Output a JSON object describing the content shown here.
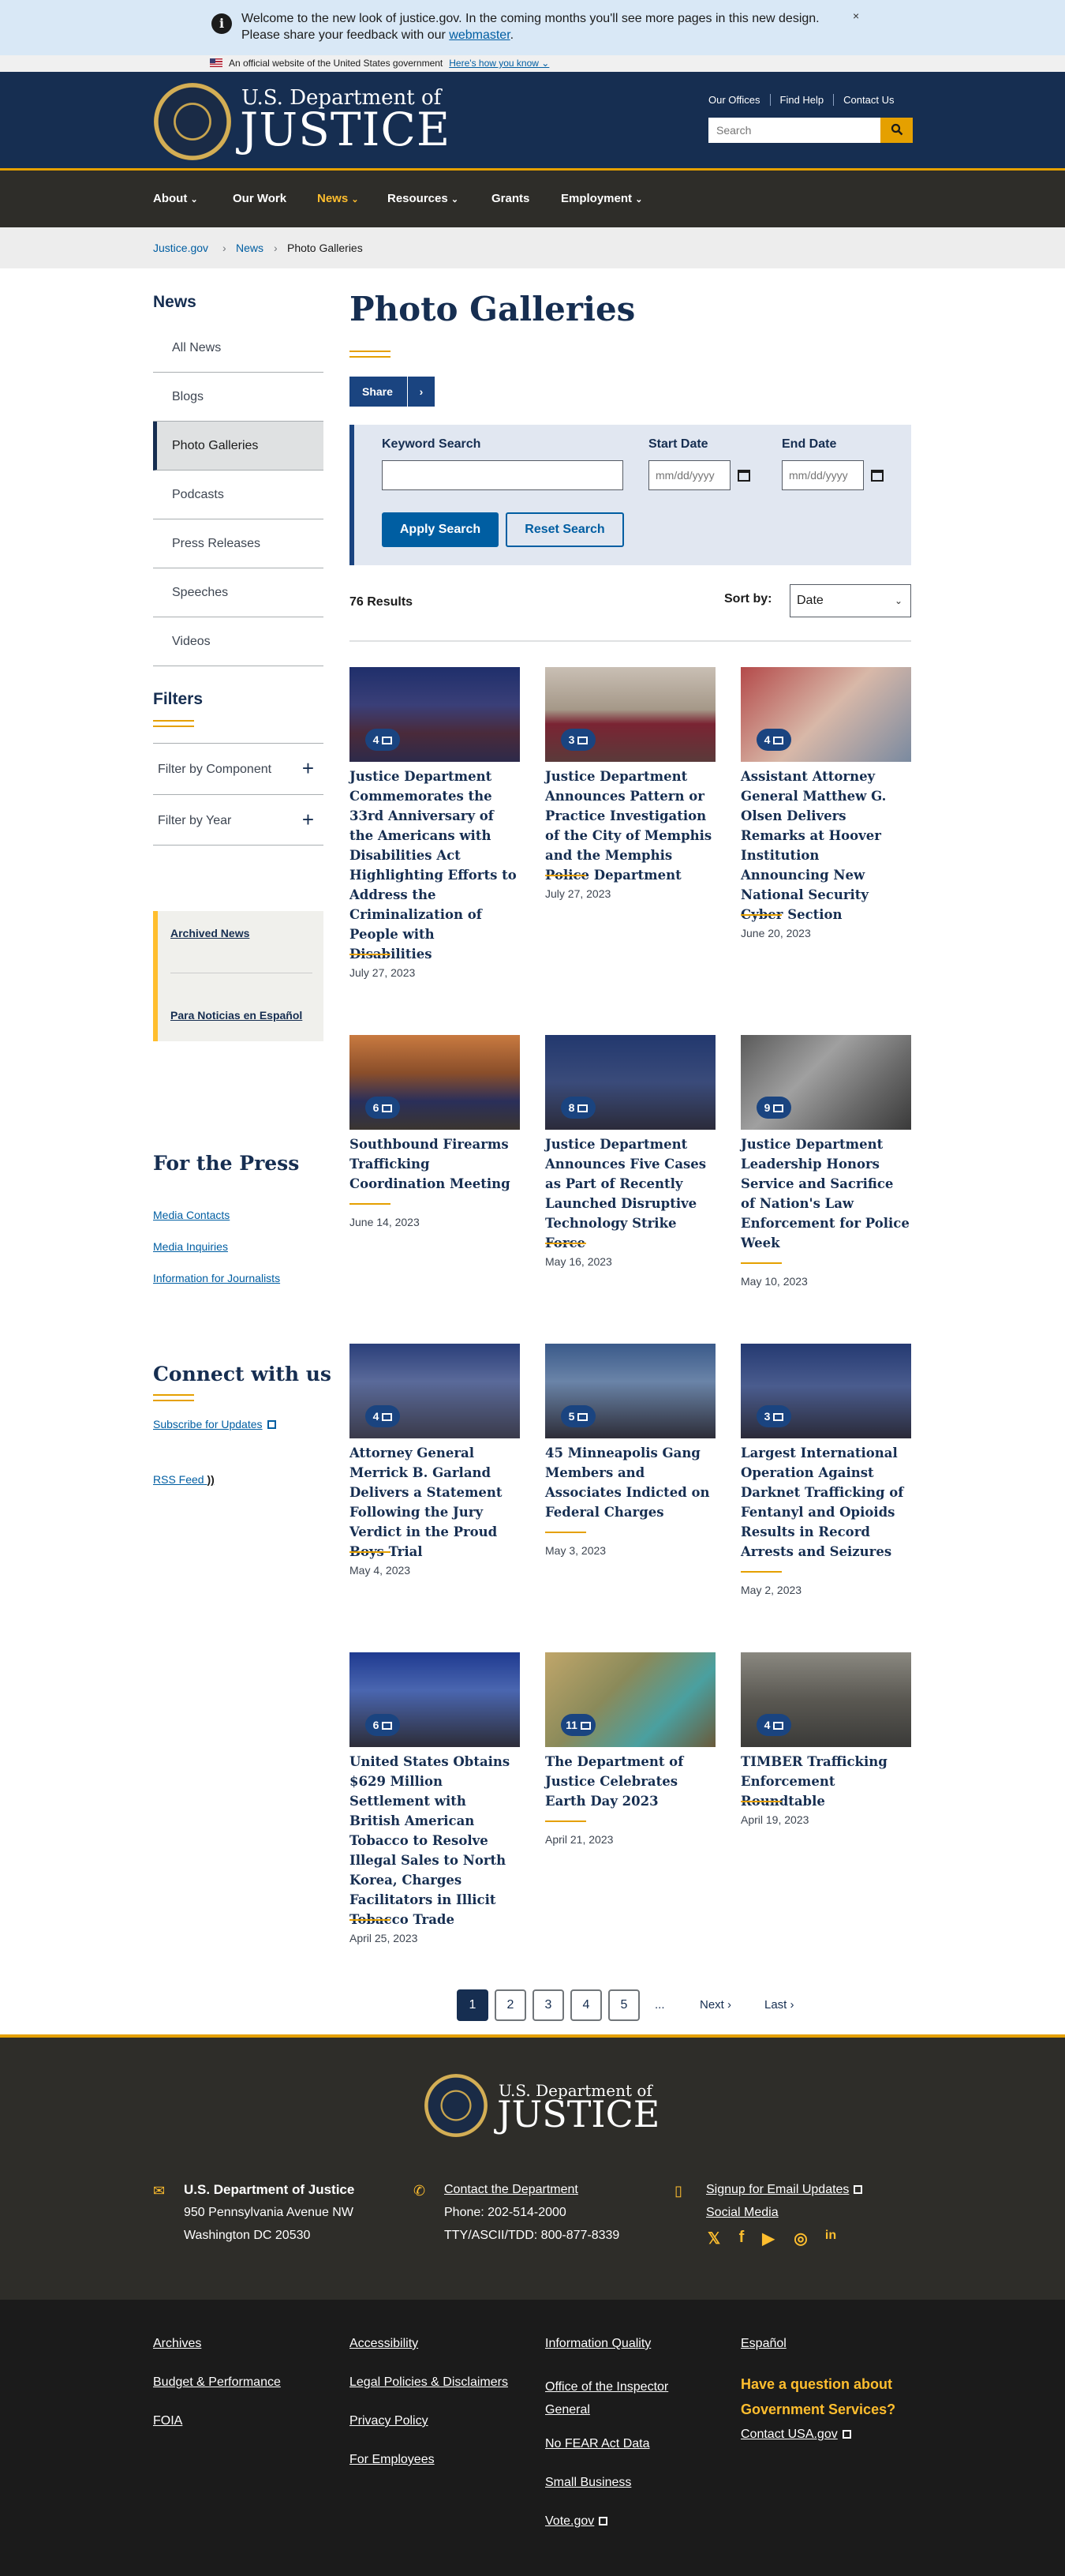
{
  "alert": {
    "message": "Welcome to the new look of justice.gov. In the coming months you'll see more pages in this new design. Please share your feedback with our",
    "link": "webmaster",
    "close": "×"
  },
  "gov_banner": {
    "text": "An official website of the United States government",
    "how": "Here's how you know"
  },
  "header": {
    "dept_line1": "U.S. Department of",
    "dept_line2": "JUSTICE",
    "util_links": [
      "Our Offices",
      "Find Help",
      "Contact Us"
    ],
    "search_placeholder": "Search"
  },
  "nav": {
    "items": [
      "About",
      "Our Work",
      "News",
      "Resources",
      "Grants",
      "Employment"
    ]
  },
  "breadcrumb": [
    "Justice.gov",
    "News",
    "Photo Galleries"
  ],
  "sidebar": {
    "title": "News",
    "items": [
      "All News",
      "Blogs",
      "Photo Galleries",
      "Podcasts",
      "Press Releases",
      "Speeches",
      "Videos"
    ],
    "filters_title": "Filters",
    "filters": [
      "Filter by Component",
      "Filter by Year"
    ],
    "archive_links": [
      "Archived News",
      "Para Noticias en Español"
    ],
    "press_title": "For the Press",
    "press_links": [
      "Media Contacts",
      "Media Inquiries",
      "Information for Journalists"
    ],
    "connect_title": "Connect with us",
    "connect_links": [
      "Subscribe for Updates",
      "RSS Feed"
    ]
  },
  "main": {
    "title": "Photo Galleries",
    "share": "Share",
    "form": {
      "keyword_label": "Keyword Search",
      "start_label": "Start Date",
      "end_label": "End Date",
      "date_placeholder": "mm/dd/yyyy",
      "apply": "Apply Search",
      "reset": "Reset Search"
    },
    "results": "76 Results",
    "sort_label": "Sort by:",
    "sort_value": "Date",
    "cards": [
      {
        "count": "4",
        "title": "Justice Department Commemorates the 33rd Anniversary of the Americans with Disabilities Act Highlighting Efforts to Address the Criminalization of People with Disabilities",
        "date": "July 27, 2023"
      },
      {
        "count": "3",
        "title": "Justice Department Announces Pattern or Practice Investigation of the City of Memphis and the Memphis Police Department",
        "date": "July 27, 2023"
      },
      {
        "count": "4",
        "title": "Assistant Attorney General Matthew G. Olsen Delivers Remarks at Hoover Institution Announcing New National Security Cyber Section",
        "date": "June 20, 2023"
      },
      {
        "count": "6",
        "title": "Southbound Firearms Trafficking Coordination Meeting",
        "date": "June 14, 2023"
      },
      {
        "count": "8",
        "title": "Justice Department Announces Five Cases as Part of Recently Launched Disruptive Technology Strike Force",
        "date": "May 16, 2023"
      },
      {
        "count": "9",
        "title": "Justice Department Leadership Honors Service and Sacrifice of Nation's Law Enforcement for Police Week",
        "date": "May 10, 2023"
      },
      {
        "count": "4",
        "title": "Attorney General Merrick B. Garland Delivers a Statement Following the Jury Verdict in the Proud Boys Trial",
        "date": "May 4, 2023"
      },
      {
        "count": "5",
        "title": "45 Minneapolis Gang Members and Associates Indicted on Federal Charges",
        "date": "May 3, 2023"
      },
      {
        "count": "3",
        "title": "Largest International Operation Against Darknet Trafficking of Fentanyl and Opioids Results in Record Arrests and Seizures",
        "date": "May 2, 2023"
      },
      {
        "count": "6",
        "title": "United States Obtains $629 Million Settlement with British American Tobacco to Resolve Illegal Sales to North Korea, Charges Facilitators in Illicit Tobacco Trade",
        "date": "April 25, 2023"
      },
      {
        "count": "11",
        "title": "The Department of Justice Celebrates Earth Day 2023",
        "date": "April 21, 2023"
      },
      {
        "count": "4",
        "title": "TIMBER Trafficking Enforcement Roundtable",
        "date": "April 19, 2023"
      }
    ],
    "pagination": {
      "pages": [
        "1",
        "2",
        "3",
        "4",
        "5"
      ],
      "ellipsis": "...",
      "next": "Next ›",
      "last": "Last ›"
    }
  },
  "footer": {
    "dept_line1": "U.S. Department of",
    "dept_line2": "JUSTICE",
    "address_title": "U.S. Department of Justice",
    "address1": "950 Pennsylvania Avenue NW",
    "address2": "Washington DC 20530",
    "contact_link": "Contact the Department",
    "phone": "Phone: 202-514-2000",
    "tty": "TTY/ASCII/TDD: 800-877-8339",
    "email_updates": "Signup for Email Updates",
    "social_media": "Social Media",
    "col1": [
      "Archives",
      "Budget & Performance",
      "FOIA"
    ],
    "col2": [
      "Accessibility",
      "Legal Policies & Disclaimers",
      "Privacy Policy",
      "For Employees"
    ],
    "col3": [
      "Information Quality",
      "Office of the Inspector General",
      "No FEAR Act Data",
      "Small Business",
      "Vote.gov"
    ],
    "col4_link": "Español",
    "question": "Have a question about Government Services?",
    "usa_link": "Contact USA.gov"
  }
}
